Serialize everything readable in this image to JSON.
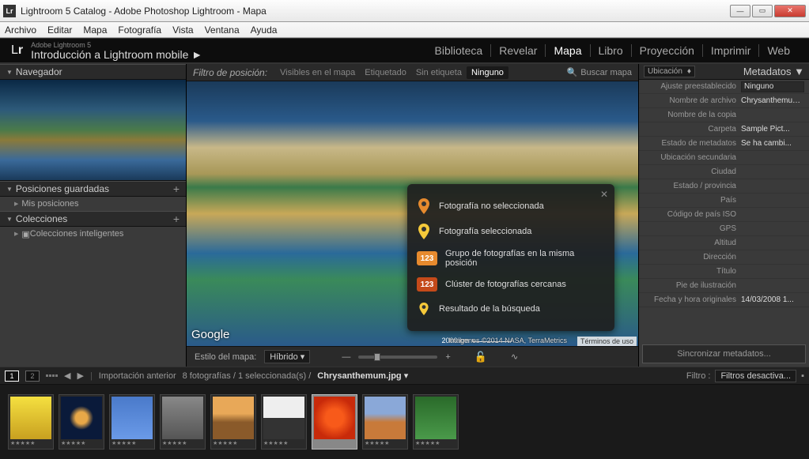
{
  "window": {
    "title": "Lightroom 5 Catalog - Adobe Photoshop Lightroom - Mapa",
    "icon_label": "Lr"
  },
  "menubar": [
    "Archivo",
    "Editar",
    "Mapa",
    "Fotografía",
    "Vista",
    "Ventana",
    "Ayuda"
  ],
  "identity": {
    "product": "Adobe Lightroom 5",
    "tagline": "Introducción a Lightroom mobile",
    "arrow": "►"
  },
  "modules": [
    {
      "label": "Biblioteca",
      "active": false
    },
    {
      "label": "Revelar",
      "active": false
    },
    {
      "label": "Mapa",
      "active": true
    },
    {
      "label": "Libro",
      "active": false
    },
    {
      "label": "Proyección",
      "active": false
    },
    {
      "label": "Imprimir",
      "active": false
    },
    {
      "label": "Web",
      "active": false
    }
  ],
  "left": {
    "navigator": "Navegador",
    "saved": "Posiciones guardadas",
    "saved_item": "Mis posiciones",
    "collections": "Colecciones",
    "collections_item": "Colecciones inteligentes"
  },
  "filter": {
    "label": "Filtro de posición:",
    "opts": [
      {
        "label": "Visibles en el mapa",
        "active": false
      },
      {
        "label": "Etiquetado",
        "active": false
      },
      {
        "label": "Sin etiqueta",
        "active": false
      },
      {
        "label": "Ninguno",
        "active": true
      }
    ],
    "search": "Buscar mapa"
  },
  "legend": {
    "items": [
      {
        "type": "pin",
        "color": "#e68a2e",
        "label": "Fotografía no seleccionada"
      },
      {
        "type": "pin",
        "color": "#f5c93a",
        "label": "Fotografía seleccionada"
      },
      {
        "type": "cluster",
        "style": "light",
        "num": "123",
        "label": "Grupo de fotografías en la misma posición"
      },
      {
        "type": "cluster",
        "style": "dark",
        "num": "123",
        "label": "Clúster de fotografías cercanas"
      },
      {
        "type": "pin",
        "color": "#f5c93a",
        "label": "Resultado de la búsqueda",
        "small": true
      }
    ]
  },
  "map": {
    "google": "Google",
    "attribution": "Imágenes ©2014 NASA, TerraMetrics",
    "scale": "2000 km",
    "terms": "Términos de uso"
  },
  "maptoolbar": {
    "style_label": "Estilo del mapa:",
    "style_value": "Híbrido"
  },
  "metadata": {
    "dropdown": "Ubicación",
    "title": "Metadatos",
    "preset_label": "Ajuste preestablecido",
    "preset_value": "Ninguno",
    "rows": [
      {
        "k": "Nombre de archivo",
        "v": "Chrysanthemum.jpg"
      },
      {
        "k": "Nombre de la copia",
        "v": ""
      },
      {
        "k": "Carpeta",
        "v": "Sample Pict..."
      },
      {
        "k": "Estado de metadatos",
        "v": "Se ha cambi..."
      },
      {
        "k": "Ubicación secundaria",
        "v": ""
      },
      {
        "k": "Ciudad",
        "v": ""
      },
      {
        "k": "Estado / provincia",
        "v": ""
      },
      {
        "k": "País",
        "v": ""
      },
      {
        "k": "Código de país ISO",
        "v": ""
      },
      {
        "k": "GPS",
        "v": ""
      },
      {
        "k": "Altitud",
        "v": ""
      },
      {
        "k": "Dirección",
        "v": ""
      },
      {
        "k": "Título",
        "v": ""
      },
      {
        "k": "Pie de ilustración",
        "v": ""
      },
      {
        "k": "Fecha y hora originales",
        "v": "14/03/2008 1..."
      }
    ],
    "sync": "Sincronizar metadatos..."
  },
  "filmstrip": {
    "screens": [
      "1",
      "2"
    ],
    "prev_import": "Importación anterior",
    "count": "8 fotografías / 1 seleccionada(s) /",
    "filename": "Chrysanthemum.jpg",
    "filter_label": "Filtro :",
    "filter_value": "Filtros desactiva...",
    "thumbs": [
      {
        "cls": "t1",
        "sel": false
      },
      {
        "cls": "t2",
        "sel": false
      },
      {
        "cls": "t3",
        "sel": false
      },
      {
        "cls": "t4",
        "sel": false
      },
      {
        "cls": "t5",
        "sel": false
      },
      {
        "cls": "t6",
        "sel": false
      },
      {
        "cls": "t7",
        "sel": true
      },
      {
        "cls": "t8",
        "sel": false
      },
      {
        "cls": "t9",
        "sel": false
      }
    ]
  }
}
